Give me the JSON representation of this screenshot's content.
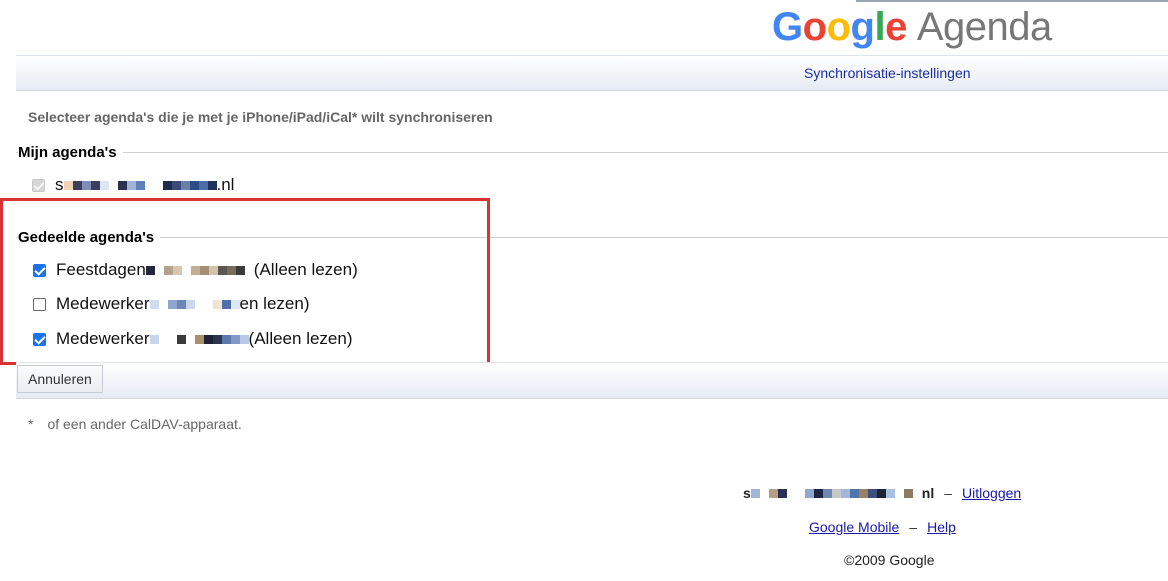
{
  "header": {
    "logo": {
      "google_letters": [
        {
          "char": "G",
          "color": "#4285F4"
        },
        {
          "char": "o",
          "color": "#EA4335"
        },
        {
          "char": "o",
          "color": "#FBBC05"
        },
        {
          "char": "g",
          "color": "#4285F4"
        },
        {
          "char": "l",
          "color": "#34A853"
        },
        {
          "char": "e",
          "color": "#EA4335"
        }
      ],
      "product": "Agenda"
    },
    "sync_settings_link": "Synchronisatie-instellingen"
  },
  "intro_text": "Selecteer agenda's die je met je iPhone/iPad/iCal* wilt synchroniseren",
  "my_calendars": {
    "title": "Mijn agenda's",
    "items": [
      {
        "label_start": "s",
        "label_end": ".nl",
        "checked": true,
        "disabled": true
      }
    ]
  },
  "shared_calendars": {
    "title": "Gedeelde agenda's",
    "items": [
      {
        "label_start": "Feestdagen",
        "label_end": "(Alleen lezen)",
        "checked": true
      },
      {
        "label_start": "Medewerker",
        "label_end": "en lezen)",
        "checked": false
      },
      {
        "label_start": "Medewerker",
        "label_end": "(Alleen lezen)",
        "checked": true
      }
    ]
  },
  "buttons": {
    "cancel": "Annuleren"
  },
  "footnote": {
    "star": "*",
    "text": "of een ander CalDAV-apparaat."
  },
  "footer": {
    "account_start": "s",
    "account_end": "nl",
    "separator": "–",
    "logout": "Uitloggen",
    "mobile": "Google Mobile",
    "help": "Help",
    "copyright": "©2009 Google"
  },
  "colors": {
    "highlight_border": "#d93434",
    "link": "#1a1aa6",
    "checkbox_checked": "#1a73e8"
  }
}
